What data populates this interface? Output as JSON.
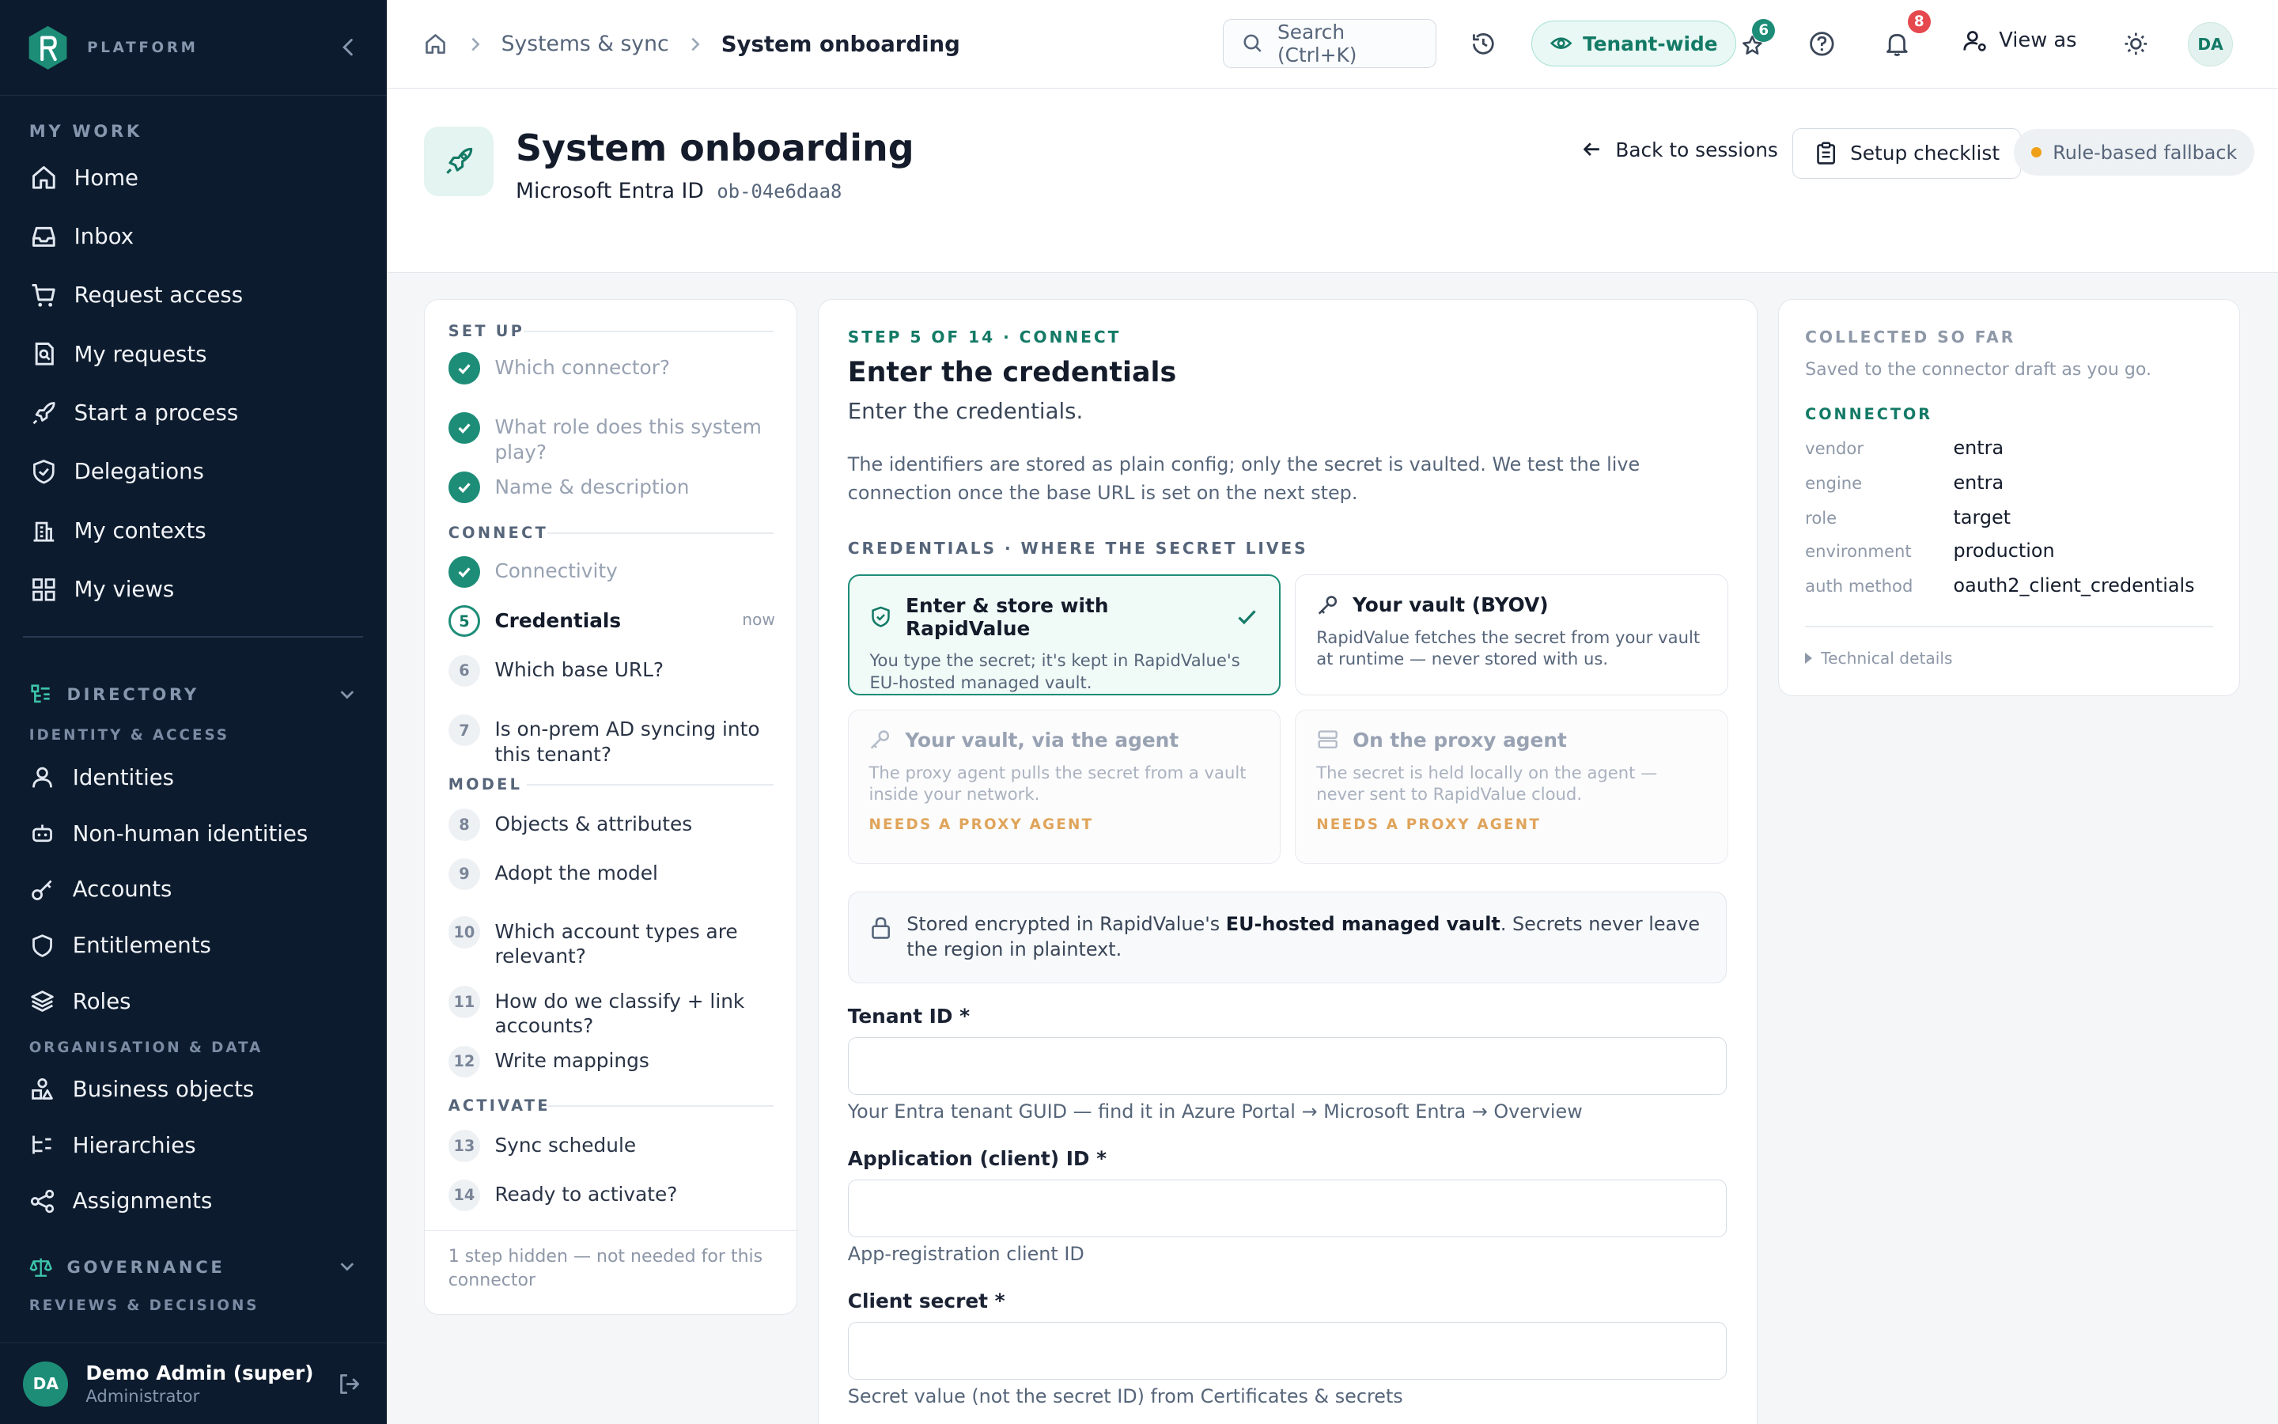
{
  "sidebar": {
    "brand": "PLATFORM",
    "my_work_title": "MY WORK",
    "my_work": [
      {
        "label": "Home",
        "icon": "home-icon"
      },
      {
        "label": "Inbox",
        "icon": "inbox-icon"
      },
      {
        "label": "Request access",
        "icon": "cart-icon"
      },
      {
        "label": "My requests",
        "icon": "requests-icon"
      },
      {
        "label": "Start a process",
        "icon": "rocket-icon"
      },
      {
        "label": "Delegations",
        "icon": "shield-icon"
      },
      {
        "label": "My contexts",
        "icon": "building-icon"
      },
      {
        "label": "My views",
        "icon": "grid-icon"
      }
    ],
    "directory": {
      "title": "DIRECTORY",
      "identity_sub": "IDENTITY & ACCESS",
      "identity_items": [
        {
          "label": "Identities",
          "icon": "user-icon"
        },
        {
          "label": "Non-human identities",
          "icon": "bot-icon"
        },
        {
          "label": "Accounts",
          "icon": "key-icon"
        },
        {
          "label": "Entitlements",
          "icon": "shield-icon"
        },
        {
          "label": "Roles",
          "icon": "layers-icon"
        }
      ],
      "org_sub": "ORGANISATION & DATA",
      "org_items": [
        {
          "label": "Business objects",
          "icon": "shapes-icon"
        },
        {
          "label": "Hierarchies",
          "icon": "hierarchy-icon"
        },
        {
          "label": "Assignments",
          "icon": "share-icon"
        }
      ]
    },
    "governance": {
      "title": "GOVERNANCE",
      "sub": "REVIEWS & DECISIONS"
    },
    "user": {
      "initials": "DA",
      "name": "Demo Admin (super)",
      "role": "Administrator"
    }
  },
  "topbar": {
    "breadcrumb": [
      "Systems & sync",
      "System onboarding"
    ],
    "search_placeholder": "Search (Ctrl+K)",
    "tenant_label": "Tenant-wide",
    "tasks_count": "6",
    "notifications_count": "8",
    "view_as_label": "View as",
    "avatar_initials": "DA",
    "accent": "#1d8d78",
    "notification_badge_color": "#e5484d"
  },
  "header": {
    "title": "System onboarding",
    "system_name": "Microsoft Entra ID",
    "session_id": "ob-04e6daa8",
    "back_label": "Back to sessions",
    "checklist_label": "Setup checklist",
    "fallback_label": "Rule-based fallback"
  },
  "steps": {
    "sections": {
      "setup": "SET UP",
      "connect": "CONNECT",
      "model": "MODEL",
      "activate": "ACTIVATE"
    },
    "items": [
      {
        "num": "1",
        "label": "Which connector?",
        "state": "done"
      },
      {
        "num": "2",
        "label": "What role does this system play?",
        "state": "done"
      },
      {
        "num": "3",
        "label": "Name & description",
        "state": "done"
      },
      {
        "num": "4",
        "label": "Connectivity",
        "state": "done"
      },
      {
        "num": "5",
        "label": "Credentials",
        "state": "current",
        "note": "now"
      },
      {
        "num": "6",
        "label": "Which base URL?",
        "state": "todo"
      },
      {
        "num": "7",
        "label": "Is on-prem AD syncing into this tenant?",
        "state": "todo"
      },
      {
        "num": "8",
        "label": "Objects & attributes",
        "state": "todo"
      },
      {
        "num": "9",
        "label": "Adopt the model",
        "state": "todo"
      },
      {
        "num": "10",
        "label": "Which account types are relevant?",
        "state": "todo"
      },
      {
        "num": "11",
        "label": "How do we classify + link accounts?",
        "state": "todo"
      },
      {
        "num": "12",
        "label": "Write mappings",
        "state": "todo"
      },
      {
        "num": "13",
        "label": "Sync schedule",
        "state": "todo"
      },
      {
        "num": "14",
        "label": "Ready to activate?",
        "state": "todo"
      }
    ],
    "footer": "1 step hidden — not needed for this connector"
  },
  "main": {
    "eyebrow": "STEP 5 OF 14 · CONNECT",
    "title": "Enter the credentials",
    "subtitle": "Enter the credentials.",
    "description": "The identifiers are stored as plain config; only the secret is vaulted. We test the live connection once the base URL is set on the next step.",
    "section": "CREDENTIALS · WHERE THE SECRET LIVES",
    "options": [
      {
        "title": "Enter & store with RapidValue",
        "desc": "You type the secret; it's kept in RapidValue's EU-hosted managed vault.",
        "icon": "shield-check-icon",
        "selected": true
      },
      {
        "title": "Your vault (BYOV)",
        "desc": "RapidValue fetches the secret from your vault at runtime — never stored with us.",
        "icon": "key-icon"
      },
      {
        "title": "Your vault, via the agent",
        "desc": "The proxy agent pulls the secret from a vault inside your network.",
        "icon": "key-icon",
        "warning": "NEEDS A PROXY AGENT",
        "disabled": true
      },
      {
        "title": "On the proxy agent",
        "desc": "The secret is held locally on the agent — never sent to RapidValue cloud.",
        "icon": "server-icon",
        "warning": "NEEDS A PROXY AGENT",
        "disabled": true
      }
    ],
    "info": {
      "prefix": "Stored encrypted in RapidValue's ",
      "bold": "EU-hosted managed vault",
      "suffix": ". Secrets never leave the region in plaintext."
    },
    "fields": [
      {
        "label": "Tenant ID *",
        "value": "",
        "help": "Your Entra tenant GUID — find it in Azure Portal → Microsoft Entra → Overview"
      },
      {
        "label": "Application (client) ID *",
        "value": "",
        "help": "App-registration client ID"
      },
      {
        "label": "Client secret *",
        "value": "",
        "help": "Secret value (not the secret ID) from Certificates & secrets"
      }
    ]
  },
  "collected": {
    "title": "COLLECTED SO FAR",
    "subtitle": "Saved to the connector draft as you go.",
    "section": "CONNECTOR",
    "rows": [
      {
        "key": "vendor",
        "value": "entra"
      },
      {
        "key": "engine",
        "value": "entra"
      },
      {
        "key": "role",
        "value": "target"
      },
      {
        "key": "environment",
        "value": "production"
      },
      {
        "key": "auth method",
        "value": "oauth2_client_credentials"
      }
    ],
    "technical": "Technical details"
  }
}
